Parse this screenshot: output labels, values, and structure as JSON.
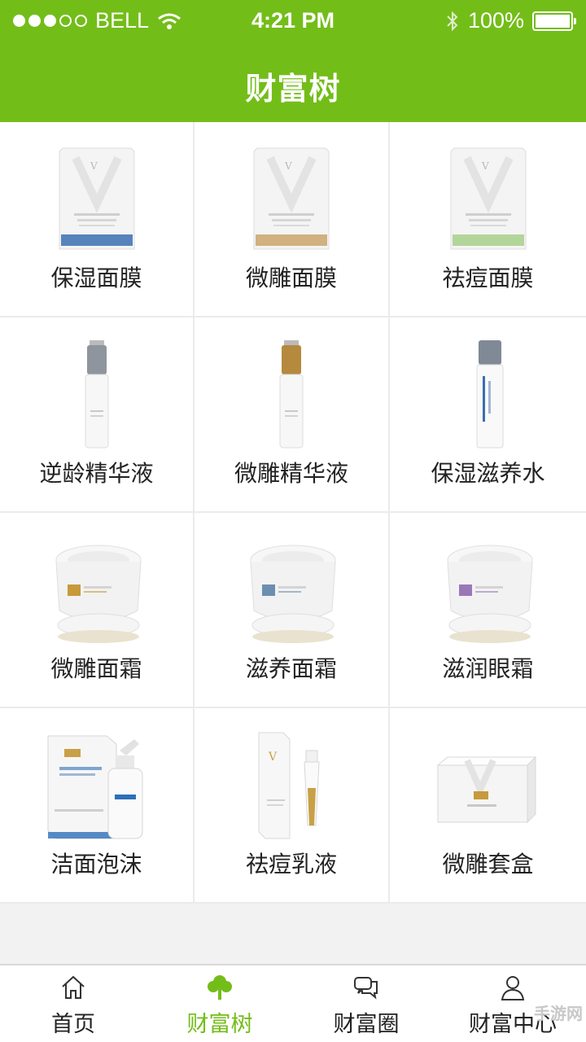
{
  "status": {
    "carrier": "BELL",
    "time": "4:21 PM",
    "battery": "100%"
  },
  "header": {
    "title": "财富树"
  },
  "products": [
    {
      "label": "保湿面膜",
      "kind": "mask",
      "accent": "#3a6fb0"
    },
    {
      "label": "微雕面膜",
      "kind": "mask",
      "accent": "#c9a46a"
    },
    {
      "label": "祛痘面膜",
      "kind": "mask",
      "accent": "#a7cf8a"
    },
    {
      "label": "逆龄精华液",
      "kind": "serum",
      "accent": "#8f959c"
    },
    {
      "label": "微雕精华液",
      "kind": "serum",
      "accent": "#b58a3e"
    },
    {
      "label": "保湿滋养水",
      "kind": "toner",
      "accent": "#7f8a96"
    },
    {
      "label": "微雕面霜",
      "kind": "cream",
      "accent": "#c79a3a"
    },
    {
      "label": "滋养面霜",
      "kind": "cream",
      "accent": "#6b8fb0"
    },
    {
      "label": "滋润眼霜",
      "kind": "cream",
      "accent": "#9a78b8"
    },
    {
      "label": "洁面泡沫",
      "kind": "foam",
      "accent": "#2d6fb8"
    },
    {
      "label": "祛痘乳液",
      "kind": "tube",
      "accent": "#c9a046"
    },
    {
      "label": "微雕套盒",
      "kind": "box",
      "accent": "#c79a3a"
    }
  ],
  "tabs": [
    {
      "label": "首页",
      "icon": "home-icon",
      "active": false
    },
    {
      "label": "财富树",
      "icon": "tree-icon",
      "active": true
    },
    {
      "label": "财富圈",
      "icon": "chat-icon",
      "active": false
    },
    {
      "label": "财富中心",
      "icon": "user-icon",
      "active": false
    }
  ],
  "watermark": "手游网",
  "colors": {
    "brand": "#73bd19",
    "active_tab": "#73bd19"
  }
}
